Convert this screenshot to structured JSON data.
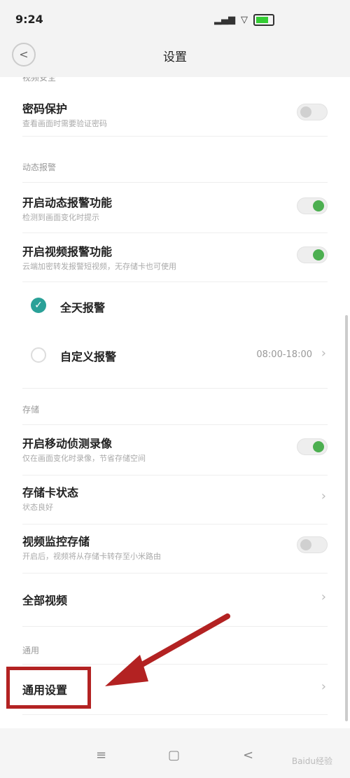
{
  "status_bar": {
    "time": "9:24",
    "signal": "▂▄▆",
    "wifi": "▽"
  },
  "header": {
    "title": "设置",
    "back_label": "<"
  },
  "sections": {
    "hidden": "视频安全",
    "dynamic": "动态报警",
    "storage": "存储",
    "general": "通用"
  },
  "rows": {
    "password": {
      "title": "密码保护",
      "subtitle": "查看画面时需要验证密码",
      "toggle": "off"
    },
    "motion_alarm": {
      "title": "开启动态报警功能",
      "subtitle": "检测到画面变化时提示",
      "toggle": "on"
    },
    "video_alarm": {
      "title": "开启视频报警功能",
      "subtitle": "云端加密转发报警短视频，无存储卡也可使用",
      "toggle": "on"
    },
    "all_day": {
      "label": "全天报警",
      "selected": true
    },
    "custom": {
      "label": "自定义报警",
      "time_range": "08:00-18:00",
      "selected": false
    },
    "motion_record": {
      "title": "开启移动侦测录像",
      "subtitle": "仅在画面变化时录像，节省存储空间",
      "toggle": "on"
    },
    "sd_status": {
      "title": "存储卡状态",
      "subtitle": "状态良好"
    },
    "video_storage": {
      "title": "视频监控存储",
      "subtitle": "开启后，视频将从存储卡转存至小米路由",
      "toggle": "off"
    },
    "all_videos": {
      "title": "全部视频"
    },
    "general_settings": {
      "title": "通用设置"
    }
  },
  "nav": {
    "menu": "≡",
    "home": "▢",
    "back": "<"
  },
  "watermark": "Baidu经验",
  "colors": {
    "accent_green": "#4caf50",
    "check_teal": "#2aa198",
    "annotation_red": "#b32222"
  }
}
